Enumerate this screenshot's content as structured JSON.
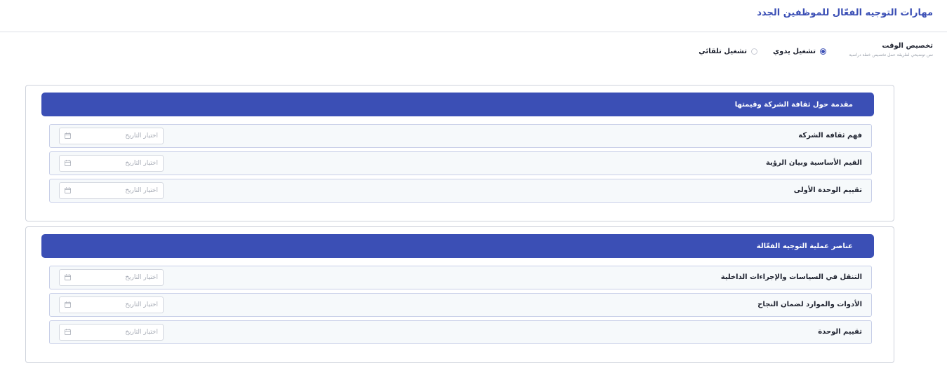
{
  "page": {
    "title": "مهارات التوجيه الفعّال للموظفين الجدد"
  },
  "time_allocation": {
    "title": "تخصيص الوقت",
    "description": "نص توضيحي لطريقة عمل تخصيص خطة دراسية",
    "options": [
      {
        "label": "تشغيل يدوي",
        "selected": true
      },
      {
        "label": "تشغيل تلقائي",
        "selected": false
      }
    ]
  },
  "date_placeholder": "اختيار التاريخ",
  "sections": [
    {
      "title": "مقدمة حول ثقافة الشركة وقيمتها",
      "items": [
        "فهم ثقافة الشركة",
        "القيم الأساسية وبيان الرؤية",
        "تقييم الوحدة الأولى"
      ]
    },
    {
      "title": "عناصر عملية التوجيه الفعّالة",
      "items": [
        "التنقل في السياسات والإجراءات الداخلية",
        "الأدوات والموارد لضمان النجاح",
        "تقييم الوحدة"
      ]
    }
  ],
  "colors": {
    "accent": "#3b4fb5",
    "row_bg": "#f6f9fb",
    "row_border": "#c8cfe8"
  }
}
